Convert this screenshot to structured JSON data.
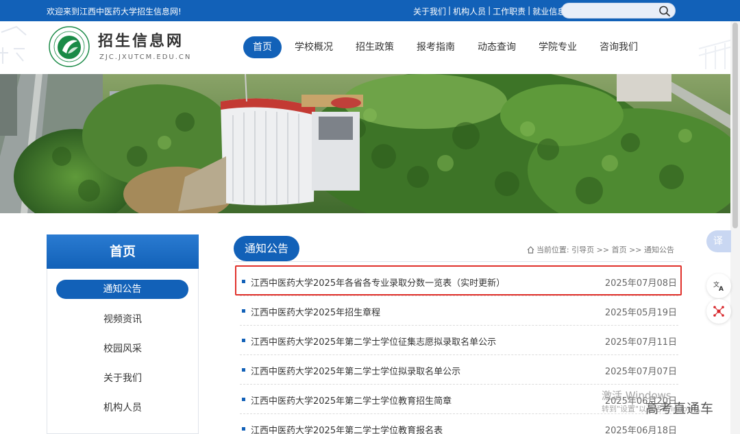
{
  "topbar": {
    "welcome": "欢迎来到江西中医药大学招生信息网!",
    "links": [
      "关于我们",
      "机构人员",
      "工作职责",
      "就业信息网"
    ],
    "search_placeholder": ""
  },
  "header": {
    "site_title": "招生信息网",
    "site_domain": "ZJC.JXUTCM.EDU.CN",
    "nav": [
      "首页",
      "学校概况",
      "招生政策",
      "报考指南",
      "动态查询",
      "学院专业",
      "咨询我们"
    ],
    "active_nav": "首页"
  },
  "sidebar": {
    "title": "首页",
    "items": [
      "通知公告",
      "视频资讯",
      "校园风采",
      "关于我们",
      "机构人员"
    ],
    "active_item": "通知公告"
  },
  "main": {
    "section_title": "通知公告",
    "breadcrumb": "当前位置: 引导页 >> 首页 >> 通知公告",
    "news": [
      {
        "title": "江西中医药大学2025年各省各专业录取分数一览表（实时更新）",
        "date": "2025年07月08日"
      },
      {
        "title": "江西中医药大学2025年招生章程",
        "date": "2025年05月19日"
      },
      {
        "title": "江西中医药大学2025年第二学士学位征集志愿拟录取名单公示",
        "date": "2025年07月11日"
      },
      {
        "title": "江西中医药大学2025年第二学士学位拟录取名单公示",
        "date": "2025年07月07日"
      },
      {
        "title": "江西中医药大学2025年第二学士学位教育招生简章",
        "date": "2025年06月20日"
      },
      {
        "title": "江西中医药大学2025年第二学士学位教育报名表",
        "date": "2025年06月18日"
      }
    ]
  },
  "floating": {
    "translate_label": "译"
  },
  "watermarks": {
    "windows_line1": "激活 Windows",
    "windows_line2": "转到\"设置\"以激活 Windows。",
    "brand": "高考直通车"
  },
  "colors": {
    "primary": "#1261b8",
    "highlight_border": "#e0302a"
  }
}
